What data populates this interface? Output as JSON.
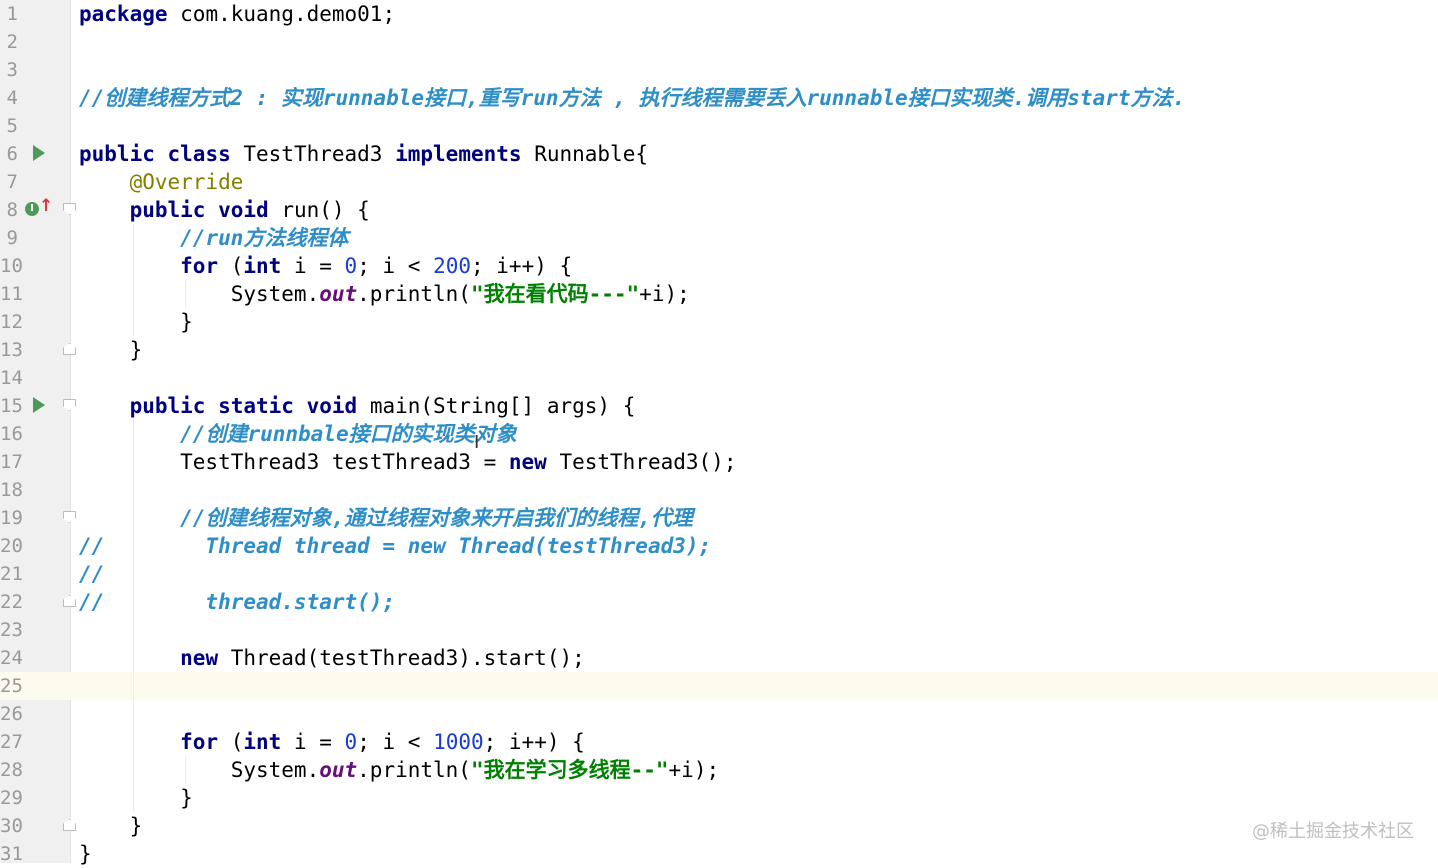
{
  "editor": {
    "current_line": 25,
    "lines": [
      {
        "n": "1",
        "tokens": [
          {
            "t": "package",
            "c": "kw"
          },
          {
            "t": " com.kuang.demo01;",
            "c": "plain"
          }
        ]
      },
      {
        "n": "2",
        "tokens": []
      },
      {
        "n": "3",
        "tokens": []
      },
      {
        "n": "4",
        "tokens": [
          {
            "t": "//创建线程方式2 : 实现runnable接口,重写run方法 , 执行线程需要丢入runnable接口实现类.调用start方法.",
            "c": "cm"
          }
        ]
      },
      {
        "n": "5",
        "tokens": []
      },
      {
        "n": "6",
        "icon": "run",
        "tokens": [
          {
            "t": "public",
            "c": "kw"
          },
          {
            "t": " ",
            "c": "plain"
          },
          {
            "t": "class",
            "c": "kw"
          },
          {
            "t": " TestThread3 ",
            "c": "plain"
          },
          {
            "t": "implements",
            "c": "kw"
          },
          {
            "t": " Runnable{",
            "c": "plain"
          }
        ]
      },
      {
        "n": "7",
        "tokens": [
          {
            "t": "    ",
            "c": "plain"
          },
          {
            "t": "@Override",
            "c": "ann"
          }
        ]
      },
      {
        "n": "8",
        "icon": "override",
        "fold": "start",
        "tokens": [
          {
            "t": "    ",
            "c": "plain"
          },
          {
            "t": "public",
            "c": "kw"
          },
          {
            "t": " ",
            "c": "plain"
          },
          {
            "t": "void",
            "c": "kw"
          },
          {
            "t": " run() {",
            "c": "plain"
          }
        ]
      },
      {
        "n": "9",
        "tokens": [
          {
            "t": "        ",
            "c": "plain"
          },
          {
            "t": "//run方法线程体",
            "c": "cm"
          }
        ]
      },
      {
        "n": "10",
        "tokens": [
          {
            "t": "        ",
            "c": "plain"
          },
          {
            "t": "for",
            "c": "kw"
          },
          {
            "t": " (",
            "c": "plain"
          },
          {
            "t": "int",
            "c": "kw"
          },
          {
            "t": " i = ",
            "c": "plain"
          },
          {
            "t": "0",
            "c": "num"
          },
          {
            "t": "; i < ",
            "c": "plain"
          },
          {
            "t": "200",
            "c": "num"
          },
          {
            "t": "; i++) {",
            "c": "plain"
          }
        ]
      },
      {
        "n": "11",
        "tokens": [
          {
            "t": "            System.",
            "c": "plain"
          },
          {
            "t": "out",
            "c": "field"
          },
          {
            "t": ".println(",
            "c": "plain"
          },
          {
            "t": "\"我在看代码---\"",
            "c": "str"
          },
          {
            "t": "+i);",
            "c": "plain"
          }
        ]
      },
      {
        "n": "12",
        "tokens": [
          {
            "t": "        }",
            "c": "plain"
          }
        ]
      },
      {
        "n": "13",
        "fold": "end",
        "tokens": [
          {
            "t": "    }",
            "c": "plain"
          }
        ]
      },
      {
        "n": "14",
        "tokens": []
      },
      {
        "n": "15",
        "icon": "run",
        "fold": "start",
        "tokens": [
          {
            "t": "    ",
            "c": "plain"
          },
          {
            "t": "public",
            "c": "kw"
          },
          {
            "t": " ",
            "c": "plain"
          },
          {
            "t": "static",
            "c": "kw"
          },
          {
            "t": " ",
            "c": "plain"
          },
          {
            "t": "void",
            "c": "kw"
          },
          {
            "t": " main(String[] args) {",
            "c": "plain"
          }
        ]
      },
      {
        "n": "16",
        "tokens": [
          {
            "t": "        ",
            "c": "plain"
          },
          {
            "t": "//创建runnbale接口的实现类对象",
            "c": "cm"
          }
        ]
      },
      {
        "n": "17",
        "tokens": [
          {
            "t": "        TestThread3 testThread3 = ",
            "c": "plain"
          },
          {
            "t": "new",
            "c": "kw"
          },
          {
            "t": " TestThread3();",
            "c": "plain"
          }
        ]
      },
      {
        "n": "18",
        "tokens": []
      },
      {
        "n": "19",
        "fold": "start",
        "tokens": [
          {
            "t": "        ",
            "c": "plain"
          },
          {
            "t": "//创建线程对象,通过线程对象来开启我们的线程,代理",
            "c": "cm"
          }
        ]
      },
      {
        "n": "20",
        "tokens": [
          {
            "t": "//        Thread thread = new Thread(testThread3);",
            "c": "cm"
          }
        ]
      },
      {
        "n": "21",
        "tokens": [
          {
            "t": "//",
            "c": "cm"
          }
        ]
      },
      {
        "n": "22",
        "fold": "end",
        "tokens": [
          {
            "t": "//        thread.start();",
            "c": "cm"
          }
        ]
      },
      {
        "n": "23",
        "tokens": []
      },
      {
        "n": "24",
        "tokens": [
          {
            "t": "        ",
            "c": "plain"
          },
          {
            "t": "new",
            "c": "kw"
          },
          {
            "t": " Thread(testThread3).start();",
            "c": "plain"
          }
        ]
      },
      {
        "n": "25",
        "tokens": []
      },
      {
        "n": "26",
        "tokens": []
      },
      {
        "n": "27",
        "tokens": [
          {
            "t": "        ",
            "c": "plain"
          },
          {
            "t": "for",
            "c": "kw"
          },
          {
            "t": " (",
            "c": "plain"
          },
          {
            "t": "int",
            "c": "kw"
          },
          {
            "t": " i = ",
            "c": "plain"
          },
          {
            "t": "0",
            "c": "num"
          },
          {
            "t": "; i < ",
            "c": "plain"
          },
          {
            "t": "1000",
            "c": "num"
          },
          {
            "t": "; i++) {",
            "c": "plain"
          }
        ]
      },
      {
        "n": "28",
        "tokens": [
          {
            "t": "            System.",
            "c": "plain"
          },
          {
            "t": "out",
            "c": "field"
          },
          {
            "t": ".println(",
            "c": "plain"
          },
          {
            "t": "\"我在学习多线程--\"",
            "c": "str"
          },
          {
            "t": "+i);",
            "c": "plain"
          }
        ]
      },
      {
        "n": "29",
        "tokens": [
          {
            "t": "        }",
            "c": "plain"
          }
        ]
      },
      {
        "n": "30",
        "fold": "end",
        "tokens": [
          {
            "t": "    }",
            "c": "plain"
          }
        ]
      },
      {
        "n": "31",
        "tokens": [
          {
            "t": "}",
            "c": "plain"
          }
        ]
      }
    ]
  },
  "watermark": "@稀土掘金技术社区",
  "colors": {
    "keyword": "#000080",
    "number": "#1a3bd4",
    "string": "#008000",
    "comment": "#2e8ec7",
    "field": "#660e7a",
    "annotation": "#808000",
    "current_line_bg": "#fdfbee",
    "gutter_bg": "#f0f0f0"
  }
}
